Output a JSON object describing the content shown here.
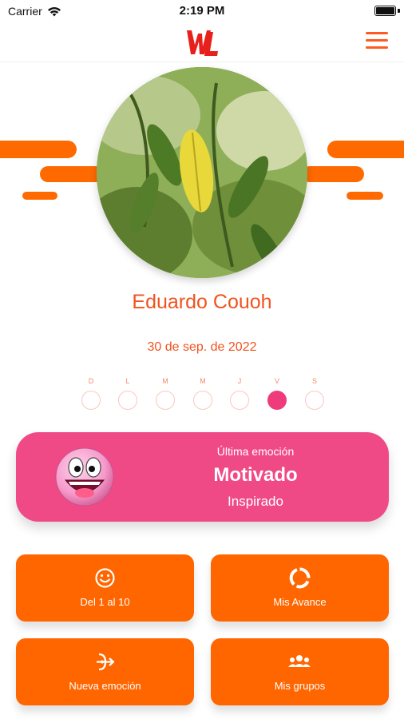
{
  "status_bar": {
    "carrier": "Carrier",
    "time": "2:19 PM",
    "battery_level": 1.0
  },
  "nav": {
    "logo_icon": "wl-logo-icon",
    "menu_icon": "hamburger-menu-icon"
  },
  "profile": {
    "name": "Eduardo Couoh",
    "date": "30 de sep. de 2022"
  },
  "week": {
    "days": [
      "D",
      "L",
      "M",
      "M",
      "J",
      "V",
      "S"
    ],
    "selected_index": 5
  },
  "emotion": {
    "label": "Última emoción",
    "main": "Motivado",
    "sub": "Inspirado",
    "icon": "happy-face-icon"
  },
  "tiles": [
    {
      "label": "Del 1 al 10",
      "icon": "smiley-icon"
    },
    {
      "label": "Mis Avance",
      "icon": "progress-ring-icon"
    },
    {
      "label": "Nueva emoción",
      "icon": "arrow-path-icon"
    },
    {
      "label": "Mis grupos",
      "icon": "group-icon"
    }
  ],
  "colors": {
    "brand_orange": "#ff6600",
    "accent_red": "#f0531e",
    "emotion_pink": "#f04a86",
    "selected_dot": "#ef3b7a"
  }
}
